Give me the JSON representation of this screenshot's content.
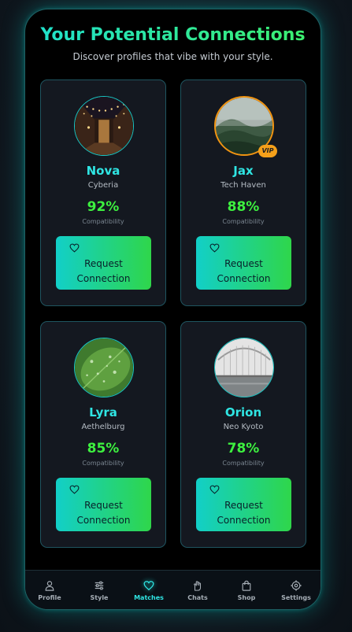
{
  "header": {
    "title": "Your Potential Connections",
    "subtitle": "Discover profiles that vibe with your style."
  },
  "profiles": [
    {
      "name": "Nova",
      "location": "Cyberia",
      "compatibility": "92%",
      "compatibility_label": "Compatibility",
      "button_label": "Request\nConnection",
      "vip": false,
      "photo": "lit-street-photo"
    },
    {
      "name": "Jax",
      "location": "Tech Haven",
      "compatibility": "88%",
      "compatibility_label": "Compatibility",
      "button_label": "Request\nConnection",
      "vip": true,
      "vip_label": "VIP",
      "photo": "misty-hills-photo"
    },
    {
      "name": "Lyra",
      "location": "Aethelburg",
      "compatibility": "85%",
      "compatibility_label": "Compatibility",
      "button_label": "Request\nConnection",
      "vip": false,
      "photo": "dewy-leaf-photo"
    },
    {
      "name": "Orion",
      "location": "Neo Kyoto",
      "compatibility": "78%",
      "compatibility_label": "Compatibility",
      "button_label": "Request\nConnection",
      "vip": false,
      "photo": "bridge-over-water-photo"
    }
  ],
  "nav": {
    "active": "Matches",
    "items": [
      {
        "label": "Profile",
        "icon": "person-icon"
      },
      {
        "label": "Style",
        "icon": "sliders-icon"
      },
      {
        "label": "Matches",
        "icon": "heart-icon"
      },
      {
        "label": "Chats",
        "icon": "hand-icon"
      },
      {
        "label": "Shop",
        "icon": "shopping-bag-icon"
      },
      {
        "label": "Settings",
        "icon": "gear-icon"
      }
    ]
  },
  "colors": {
    "accent_cyan": "#2fe5e3",
    "accent_green": "#3df03f",
    "vip_orange": "#f5a01a",
    "card_bg": "#141820",
    "card_border": "#1f5560"
  }
}
